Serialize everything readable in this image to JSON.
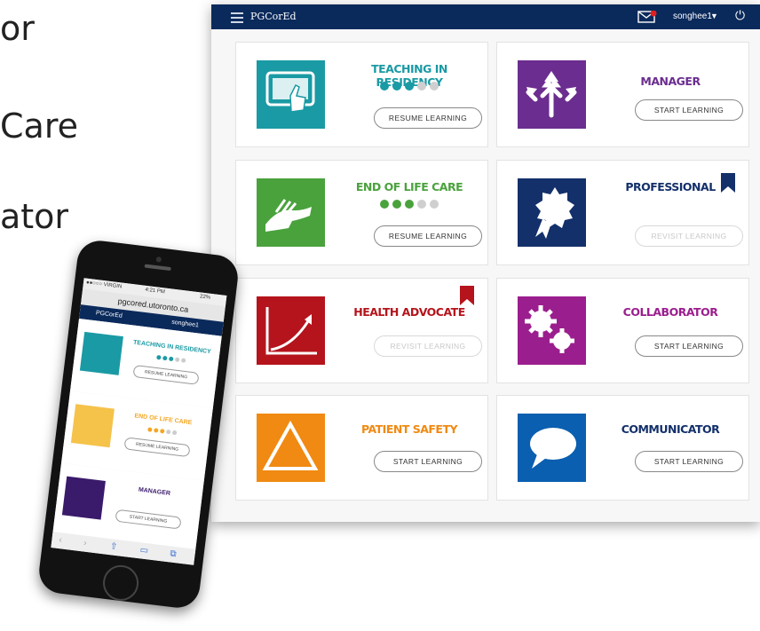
{
  "slide": {
    "partial_lines": [
      "or",
      "Care",
      "ator"
    ]
  },
  "header": {
    "brand": "PGCorEd",
    "notification_count": "1",
    "username": "songhee1",
    "caret": "▼",
    "power_symbol": "⏻"
  },
  "colors": {
    "navy": "#0b2a5c",
    "teal": "#1a9aa4",
    "green": "#4aa23d",
    "purple": "#6b2d8f",
    "dark_navy": "#13306a",
    "red": "#b5141c",
    "magenta": "#9b1e8e",
    "orange": "#f08a12",
    "blue": "#0a5fb0",
    "bookmark": "#b5141c"
  },
  "cards": [
    {
      "id": "teaching",
      "title": "TEACHING IN RESIDENCY",
      "button": "RESUME LEARNING",
      "progress_filled": 3,
      "progress_total": 5,
      "bookmarked": false,
      "icon": "tablet-tap-icon",
      "disabled": false
    },
    {
      "id": "manager",
      "title": "MANAGER",
      "button": "START LEARNING",
      "bookmarked": false,
      "icon": "arrows-icon",
      "disabled": false
    },
    {
      "id": "endoflife",
      "title": "END OF LIFE CARE",
      "button": "RESUME LEARNING",
      "progress_filled": 3,
      "progress_total": 5,
      "bookmarked": false,
      "icon": "hands-icon",
      "disabled": false
    },
    {
      "id": "professional",
      "title": "PROFESSIONAL",
      "button": "REVISIT LEARNING",
      "bookmarked": true,
      "icon": "award-ribbon-icon",
      "disabled": true
    },
    {
      "id": "healthadvocate",
      "title": "HEALTH ADVOCATE",
      "button": "REVISIT LEARNING",
      "bookmarked": true,
      "icon": "trend-arrow-icon",
      "disabled": true
    },
    {
      "id": "collaborator",
      "title": "COLLABORATOR",
      "button": "START LEARNING",
      "bookmarked": false,
      "icon": "gears-icon",
      "disabled": false
    },
    {
      "id": "patientsafety",
      "title": "PATIENT SAFETY",
      "button": "START LEARNING",
      "bookmarked": false,
      "icon": "warning-triangle-icon",
      "disabled": false
    },
    {
      "id": "communicator",
      "title": "COMMUNICATOR",
      "button": "START LEARNING",
      "bookmarked": false,
      "icon": "speech-bubble-icon",
      "disabled": false
    }
  ],
  "phone": {
    "carrier": "●●○○○ VIRGIN",
    "time": "4:21 PM",
    "battery": "22%",
    "url": "pgcored.utoronto.ca",
    "brand": "PGCorEd",
    "username": "songhee1",
    "items": [
      {
        "title": "TEACHING IN RESIDENCY",
        "button": "RESUME LEARNING"
      },
      {
        "title": "END OF LIFE CARE",
        "button": "RESUME LEARNING"
      },
      {
        "title": "MANAGER",
        "button": "START LEARNING"
      }
    ]
  }
}
